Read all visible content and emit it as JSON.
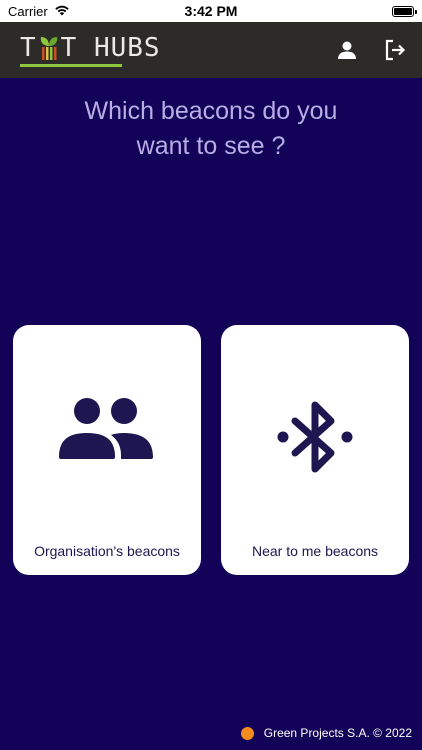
{
  "status_bar": {
    "carrier": "Carrier",
    "time": "3:42 PM",
    "icons": [
      "wifi-icon",
      "battery-icon"
    ]
  },
  "header": {
    "logo_text_1": "T",
    "logo_text_2": "T HUBS",
    "logo_colors": {
      "text": "#e9e9e6",
      "accent": "#8dc63f"
    },
    "actions": [
      "user-icon",
      "logout-icon"
    ]
  },
  "main": {
    "question_line1": "Which beacons do you",
    "question_line2": "want to see ?",
    "cards": [
      {
        "label": "Organisation's beacons",
        "icon": "people-icon"
      },
      {
        "label": "Near to me beacons",
        "icon": "bluetooth-icon"
      }
    ]
  },
  "footer": {
    "text": "Green Projects S.A. © 2022",
    "dot_color": "#f58a1f"
  },
  "colors": {
    "background": "#130358",
    "header": "#2c2b28",
    "question_text": "#b7aee6",
    "icon_color": "#1d1650"
  }
}
